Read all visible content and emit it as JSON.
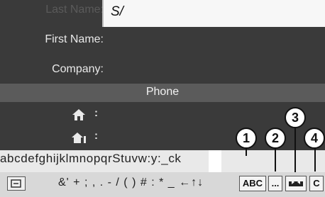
{
  "form": {
    "last_name_label": "Last Name:",
    "last_name_value": "S/",
    "first_name_label": "First Name:",
    "company_label": "Company:",
    "phone_header": "Phone",
    "phone_rows": [
      {
        "separator": ":"
      },
      {
        "separator": ":"
      }
    ]
  },
  "keyboard": {
    "letters": "abcdefghijklmnopqrStuvw:y:_ck",
    "symbols": "&' + ; , . - / ( ) # : * _ ←↑↓",
    "abc_label": "ABC",
    "more_label": "...",
    "clear_label": "C"
  },
  "callouts": [
    "1",
    "2",
    "3",
    "4"
  ]
}
